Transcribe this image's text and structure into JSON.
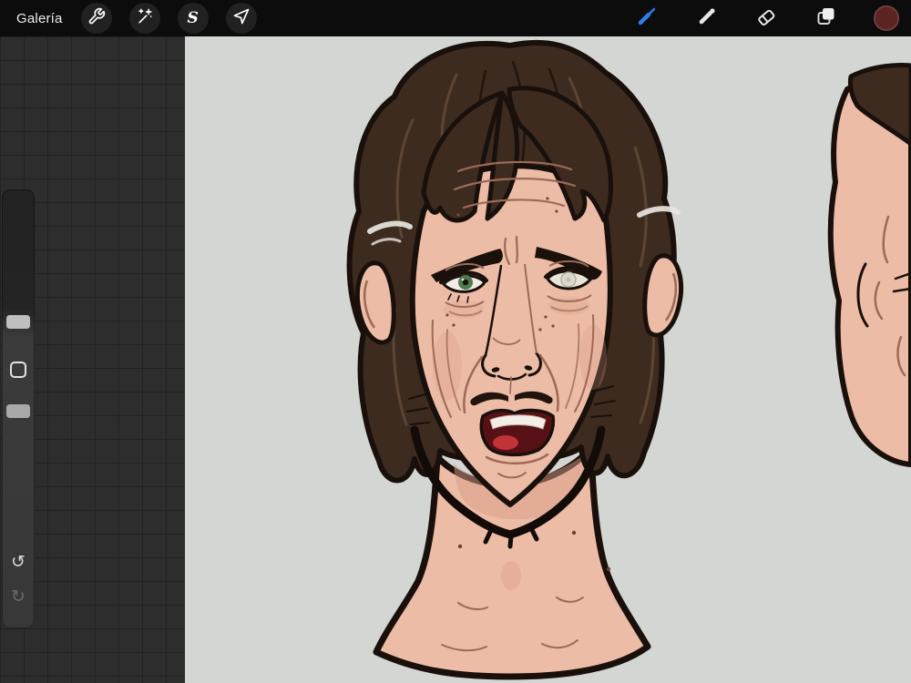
{
  "topbar": {
    "gallery_label": "Galería",
    "left_tools": [
      {
        "label": "Actions",
        "icon": "wrench-icon"
      },
      {
        "label": "Adjustments",
        "icon": "magic-wand-icon"
      },
      {
        "label": "Selection",
        "icon": "selection-icon",
        "glyph": "S"
      },
      {
        "label": "Transform",
        "icon": "transform-arrow-icon"
      }
    ],
    "right_tools": [
      {
        "label": "Paint",
        "icon": "brush-icon",
        "active": true
      },
      {
        "label": "Smudge",
        "icon": "smudge-icon",
        "active": false
      },
      {
        "label": "Erase",
        "icon": "eraser-icon",
        "active": false
      },
      {
        "label": "Layers",
        "icon": "layers-icon",
        "active": false
      },
      {
        "label": "Color",
        "icon": "color-swatch",
        "active": false
      }
    ],
    "accent_color": "#2e7ee7",
    "color_swatch_color": "#5c2422",
    "bar_background": "#0c0c0c",
    "icon_circle_background": "#212121"
  },
  "sidebar": {
    "sliders": [
      {
        "name": "brush-size-slider"
      },
      {
        "name": "opacity-slider"
      }
    ],
    "modify_button": {
      "name": "modify-button"
    },
    "undo_glyph": "↺",
    "redo_glyph": "↻"
  },
  "workspace": {
    "background": "#2d2d2d"
  },
  "canvas": {
    "background": "#d3d6d3",
    "artwork": {
      "description": "Cartoon bust portrait of an older man with messy dark-brown hair, gray streaks at temples, wrinkled face, green left eye, pale blind right eye, thin mustache, open mouth and black chin-strap beard outline; a second partial face is cropped at the right edge of the canvas",
      "colors": {
        "skin": "#ecbca6",
        "skin_shadow": "#d99c88",
        "outline": "#19100b",
        "hair": "#3d2b20",
        "hair_highlight": "#5d4533",
        "gray_streak": "#e8e6df",
        "iris": "#4f7a4e",
        "blind_eye": "#e7e4da",
        "mouth_interior": "#571015",
        "tongue": "#c03336",
        "teeth": "#f3eee6",
        "wrinkle": "#9c6a57"
      }
    }
  }
}
